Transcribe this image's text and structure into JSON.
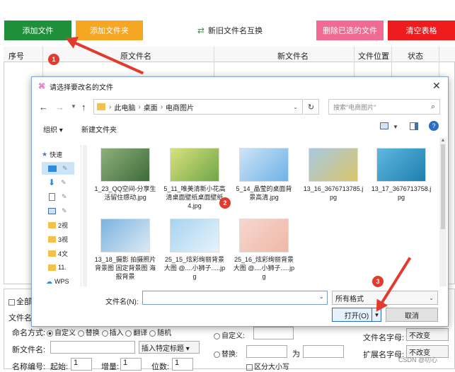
{
  "toolbar": {
    "add_file": "添加文件",
    "add_folder": "添加文件夹",
    "swap_names": "新旧文件名互换",
    "delete_selected": "删除已选的文件",
    "clear_table": "清空表格"
  },
  "table": {
    "headers": [
      "序号",
      "原文件名",
      "新文件名",
      "文件位置",
      "状态"
    ]
  },
  "badges": [
    "1",
    "2",
    "3"
  ],
  "dialog": {
    "title": "请选择要改名的文件",
    "breadcrumb": [
      "此电脑",
      "桌面",
      "电商图片"
    ],
    "search_placeholder": "搜索\"电商图片\"",
    "organize": "组织 ▾",
    "new_folder": "新建文件夹",
    "nav": [
      "快速",
      "2视",
      "3视",
      "4文",
      "11.",
      "WPS"
    ],
    "files": [
      {
        "name": "1_23_QQ空间-分享生活留住感动.jpg",
        "colors": [
          "#8fb07a",
          "#3d6b3b"
        ]
      },
      {
        "name": "5_11_唯美清新小花高清桌面壁纸桌面壁纸4.jpg",
        "colors": [
          "#d9e27a",
          "#6fa64a"
        ]
      },
      {
        "name": "5_14_晶莹的桌面背景高清.jpg",
        "colors": [
          "#cde4f7",
          "#6fb1e6"
        ]
      },
      {
        "name": "13_16_3676713785.jpg",
        "colors": [
          "#a8c9e0",
          "#d9c56b"
        ]
      },
      {
        "name": "13_17_3676713758.jpg",
        "colors": [
          "#5fb8e0",
          "#1d7fae"
        ]
      },
      {
        "name": "13_18_摄影 拍摄照片背景图 固定背景图 海报背景",
        "colors": [
          "#7ab3e0",
          "#dbe9f4"
        ]
      },
      {
        "name": "25_15_炫彩绚丽背景大图 @....小狮子.....jpg",
        "colors": [
          "#a7d3f0",
          "#e7f3fb"
        ]
      },
      {
        "name": "25_16_炫彩绚丽背景大图 @....小狮子.....jpg",
        "colors": [
          "#f5d7d0",
          "#f0b8a6"
        ]
      }
    ],
    "filename_label": "文件名(N):",
    "filename_value": "",
    "filter": "所有格式",
    "open": "打开(O)",
    "cancel": "取消"
  },
  "bottom": {
    "select_all": "全部",
    "section_file": "文件名",
    "naming_mode_label": "命名方式:",
    "naming_modes": [
      "自定义",
      "替换",
      "插入",
      "翻译",
      "随机"
    ],
    "new_filename_label": "新文件名:",
    "insert_special": "插入特定标题 ▾",
    "numbering_label": "名称编号:",
    "start_label": "起始:",
    "start_value": "1",
    "step_label": "增量:",
    "step_value": "1",
    "digits_label": "位数:",
    "digits_value": "1",
    "custom_label": "自定义:",
    "replace_label": "替换:",
    "to_label": "为",
    "case_label": "区分大小写",
    "filename_case_label": "文件名字母:",
    "filename_case_value": "不改变",
    "ext_case_label": "扩展名字母:",
    "ext_case_value": "不改变",
    "watermark": "CSDN @叨心"
  }
}
